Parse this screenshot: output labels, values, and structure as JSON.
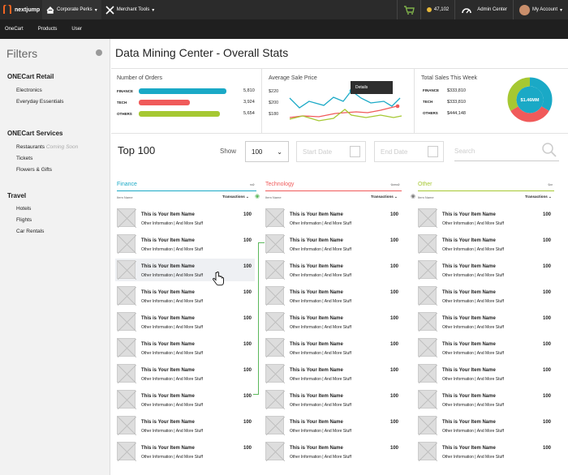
{
  "topbar": {
    "brand": "nextjump",
    "nav": [
      {
        "label": "Corporate Perks",
        "icon": "home-icon"
      },
      {
        "label": "Merchant Tools",
        "icon": "tools-icon"
      }
    ],
    "points": "47,102",
    "admin_center": "Admin Center",
    "my_account": "My Account"
  },
  "subnav": [
    "OneCart",
    "Products",
    "User"
  ],
  "sidebar": {
    "title": "Filters",
    "groups": [
      {
        "title": "ONECart Retail",
        "items": [
          "Electronics",
          "Everyday Essentials"
        ]
      },
      {
        "title": "ONECart Services",
        "items": [
          "Restaurants",
          "Tickets",
          "Flowers & Gifts"
        ],
        "coming_soon": "Coming Soon"
      },
      {
        "title": "Travel",
        "items": [
          "Hotels",
          "Flights",
          "Car Rentals"
        ]
      }
    ]
  },
  "page": {
    "title": "Data Mining Center - Overall Stats"
  },
  "stats": {
    "orders": {
      "label": "Number of Orders",
      "rows": [
        {
          "name": "FINANCE",
          "value": "5,810",
          "color": "#1aa9c6",
          "share": 0.93
        },
        {
          "name": "TECH",
          "value": "3,924",
          "color": "#f05a5a",
          "share": 0.54
        },
        {
          "name": "OTHERS",
          "value": "5,654",
          "color": "#a6c832",
          "share": 0.86
        }
      ]
    },
    "sale_price": {
      "label": "Average Sale Price",
      "y_ticks": [
        "$220",
        "$200",
        "$180"
      ],
      "tooltip": "Details"
    },
    "total_sales": {
      "label": "Total Sales This Week",
      "rows": [
        {
          "name": "FINANCE",
          "value": "$333,810"
        },
        {
          "name": "TECH",
          "value": "$333,810"
        },
        {
          "name": "OTHERS",
          "value": "$444,148"
        }
      ],
      "center": "$1.46MM"
    }
  },
  "top100": {
    "title": "Top 100",
    "show_label": "Show",
    "show_value": "100",
    "start_date": "Start Date",
    "end_date": "End Date",
    "search": "Search"
  },
  "columns": [
    {
      "title": "Finance",
      "color": "#1aa9c6",
      "item_name": "Item Name",
      "transactions": "Transactions"
    },
    {
      "title": "Technology",
      "color": "#f05a5a",
      "item_name": "Item Name",
      "transactions": "Transactions"
    },
    {
      "title": "Other",
      "color": "#a6c832",
      "item_name": "Item Name",
      "transactions": "Transactions"
    }
  ],
  "item": {
    "name": "This is Your Item Name",
    "info": "Other Information | And More Stuff",
    "count": "100"
  }
}
